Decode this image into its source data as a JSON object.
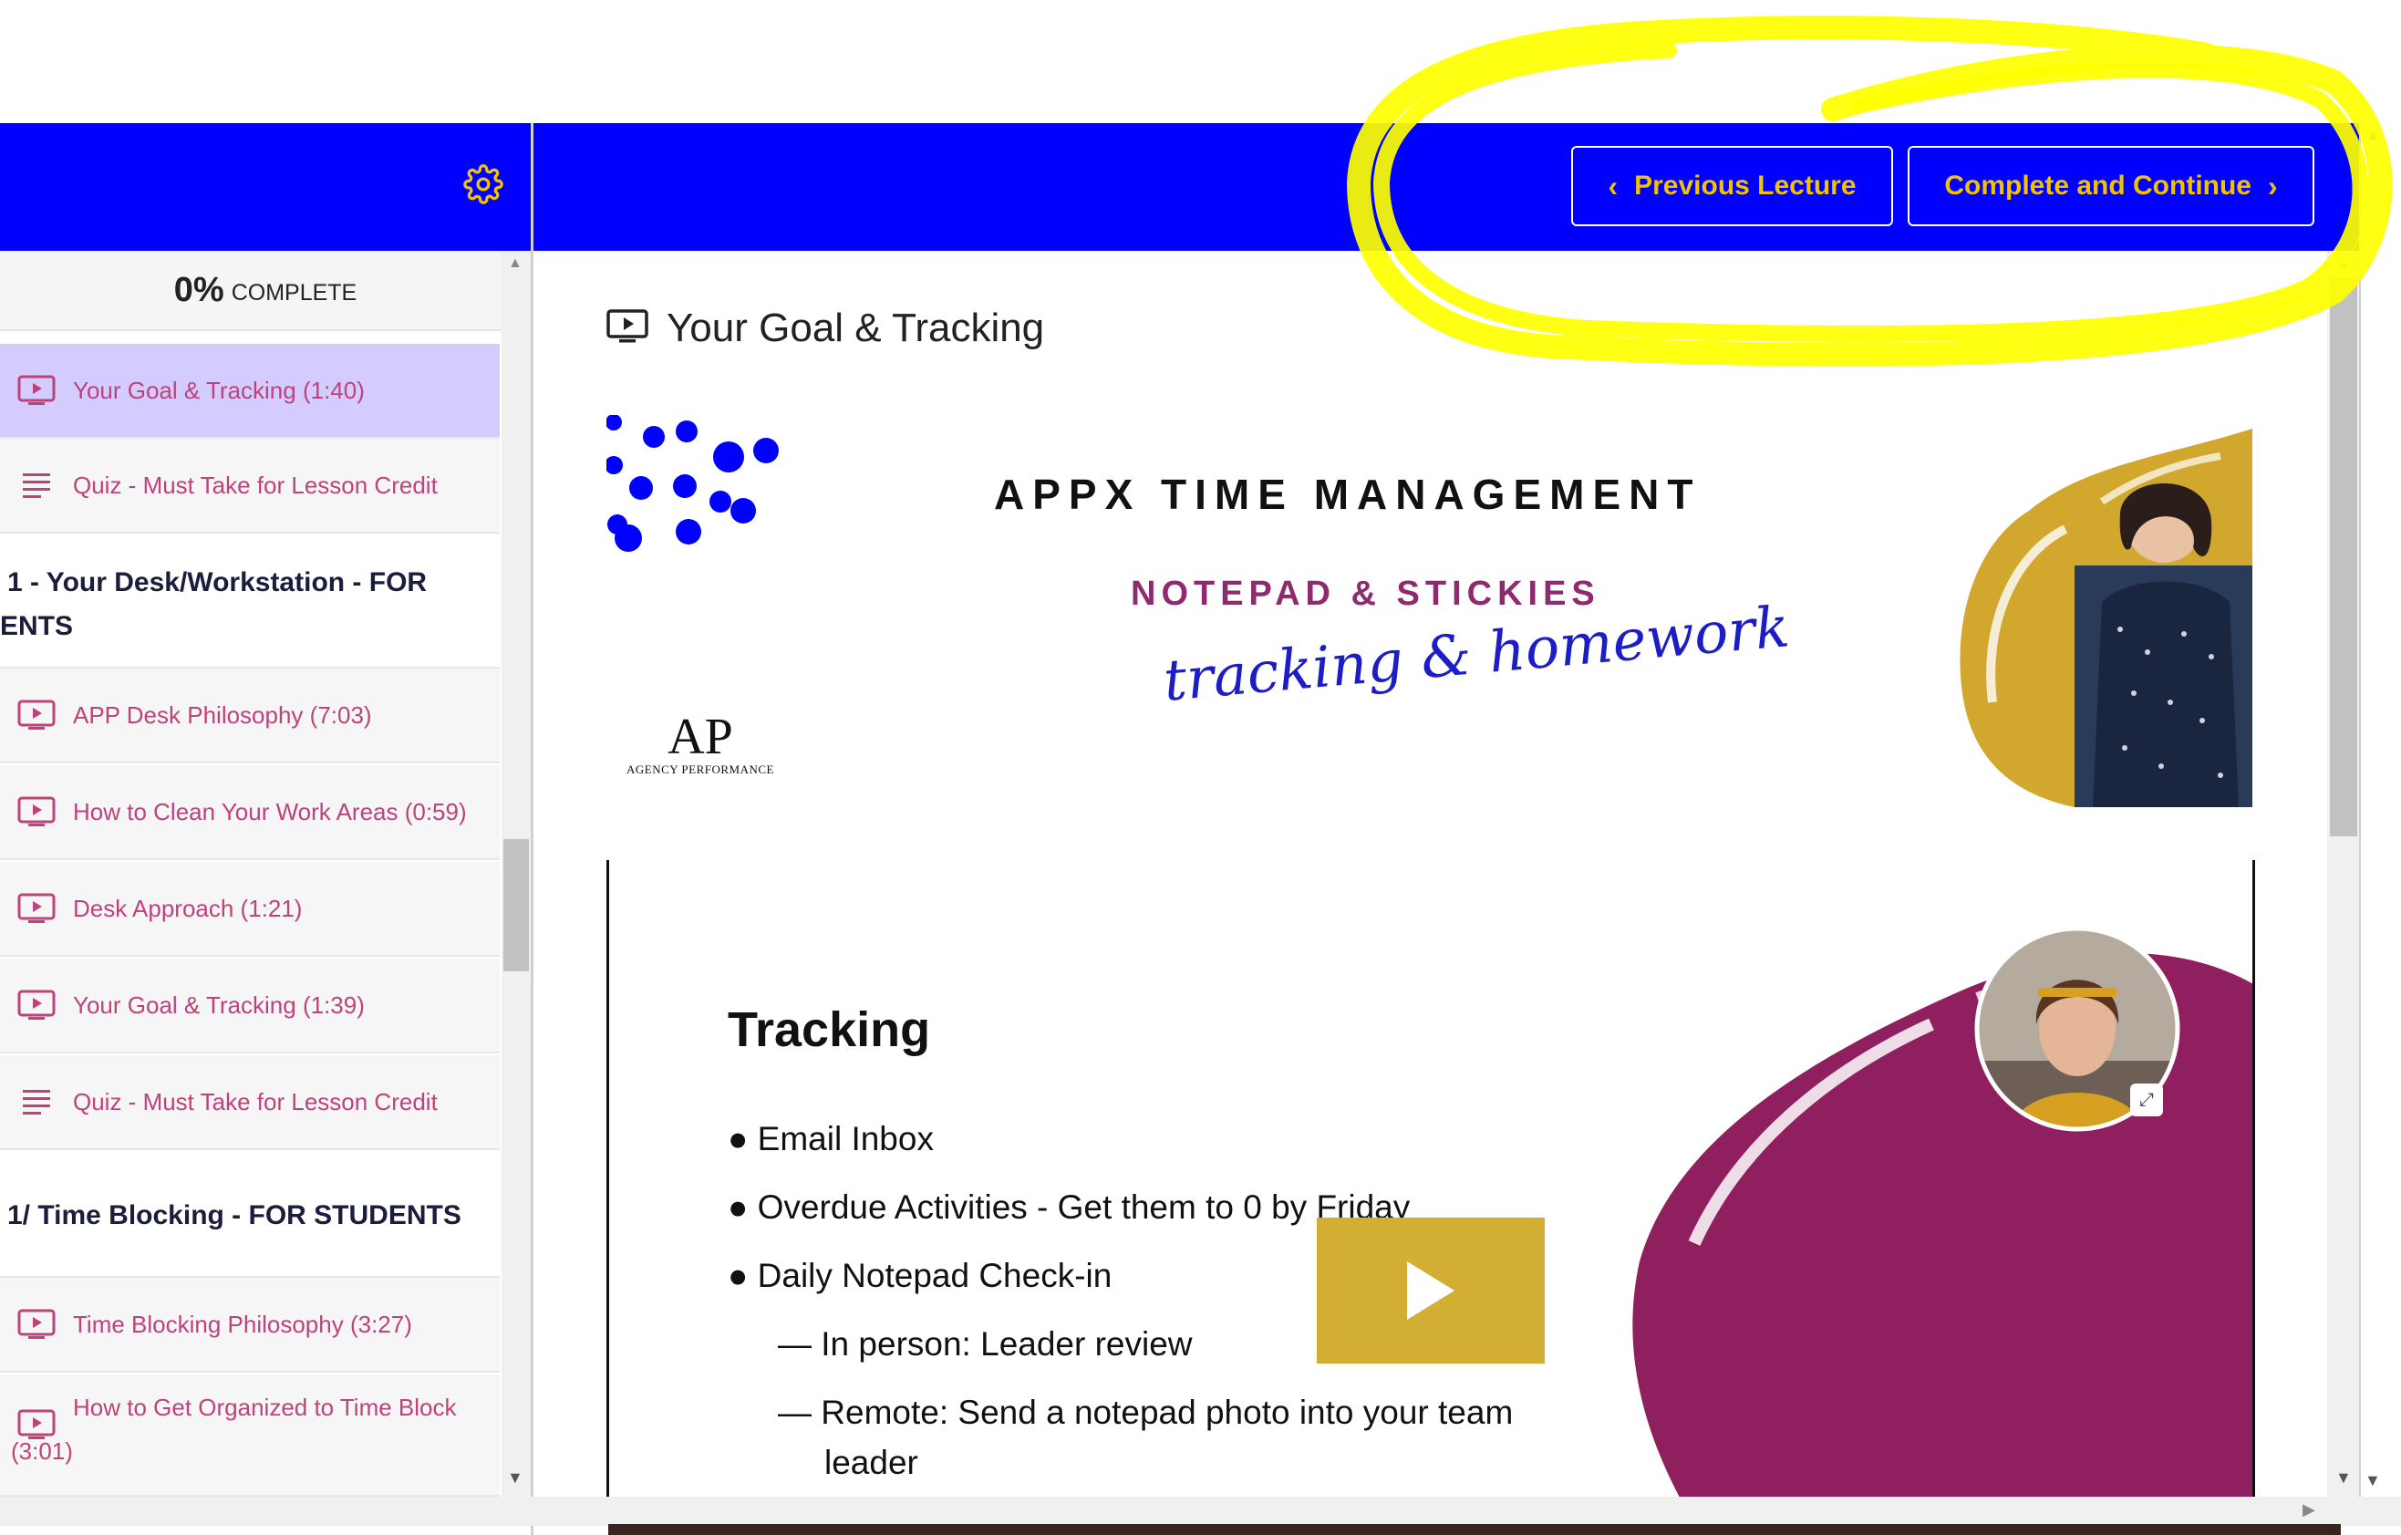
{
  "colors": {
    "brand": "#0000ff",
    "accent": "#f2c200",
    "lesson_text": "#c0427a",
    "active_lesson": "#d4ccff",
    "highlight": "#ffff00"
  },
  "header": {
    "settings_icon": "gear-icon",
    "prev_label": "Previous Lecture",
    "next_label": "Complete and Continue"
  },
  "sidebar": {
    "progress_percent": "0%",
    "progress_label": "COMPLETE",
    "items": [
      {
        "kind": "video",
        "label": "Your Goal & Tracking (1:40)",
        "active": true
      },
      {
        "kind": "quiz",
        "label": "Quiz - Must Take for Lesson Credit"
      },
      {
        "kind": "section",
        "label": "1 - Your Desk/Workstation - FOR",
        "label2": "ENTS"
      },
      {
        "kind": "video",
        "label": "APP Desk Philosophy (7:03)"
      },
      {
        "kind": "video",
        "label": "How to Clean Your Work Areas (0:59)"
      },
      {
        "kind": "video",
        "label": "Desk Approach (1:21)"
      },
      {
        "kind": "video",
        "label": "Your Goal & Tracking (1:39)"
      },
      {
        "kind": "quiz",
        "label": "Quiz - Must Take for Lesson Credit"
      },
      {
        "kind": "section",
        "label": "1/ Time Blocking - FOR STUDENTS"
      },
      {
        "kind": "video",
        "label": "Time Blocking Philosophy (3:27)"
      },
      {
        "kind": "video",
        "label": "How to Get Organized to Time Block",
        "label2": "(3:01)"
      }
    ]
  },
  "main": {
    "lesson_title": "Your Goal & Tracking",
    "banner": {
      "heading": "APPX TIME MANAGEMENT",
      "subheading": "NOTEPAD & STICKIES",
      "script_text": "tracking & homework",
      "logo_mark": "AP",
      "logo_name": "AGENCY PERFORMANCE"
    },
    "video": {
      "slide_title": "Tracking",
      "bullets": [
        "Email Inbox",
        "Overdue Activities - Get them to 0 by Friday",
        "Daily Notepad Check-in"
      ],
      "sub_bullets": [
        "In person: Leader review",
        "Remote: Send a notepad photo into your team",
        "leader"
      ],
      "play_icon": "play-icon",
      "expand_icon": "expand-icon"
    }
  }
}
